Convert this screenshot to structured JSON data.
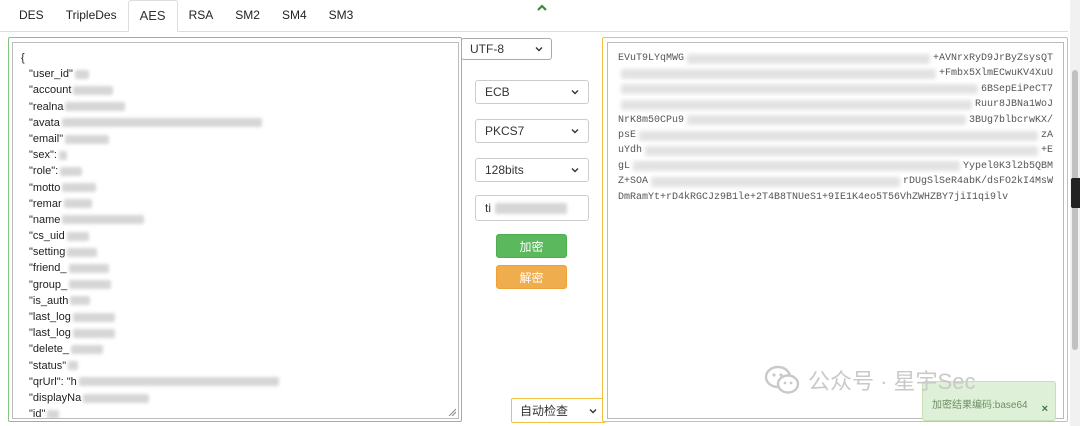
{
  "tabs": [
    {
      "label": "DES",
      "active": false
    },
    {
      "label": "TripleDes",
      "active": false
    },
    {
      "label": "AES",
      "active": true
    },
    {
      "label": "RSA",
      "active": false
    },
    {
      "label": "SM2",
      "active": false
    },
    {
      "label": "SM4",
      "active": false
    },
    {
      "label": "SM3",
      "active": false
    }
  ],
  "input": {
    "open_brace": "{",
    "close_brace": "}",
    "lines": [
      {
        "key": "\"user_id\"",
        "blur": 14
      },
      {
        "key": "\"account",
        "blur": 40
      },
      {
        "key": "\"realna",
        "blur": 60
      },
      {
        "key": "\"avata",
        "blur": 200
      },
      {
        "key": "\"email\"",
        "blur": 44
      },
      {
        "key": "\"sex\": ",
        "blur": 8
      },
      {
        "key": "\"role\":",
        "blur": 22
      },
      {
        "key": "\"motto",
        "blur": 34
      },
      {
        "key": "\"remar",
        "blur": 28
      },
      {
        "key": "\"name",
        "blur": 82
      },
      {
        "key": "\"cs_uid",
        "blur": 22
      },
      {
        "key": "\"setting",
        "blur": 30
      },
      {
        "key": "\"friend_",
        "blur": 40
      },
      {
        "key": "\"group_",
        "blur": 42
      },
      {
        "key": "\"is_auth",
        "blur": 20
      },
      {
        "key": "\"last_log",
        "blur": 42
      },
      {
        "key": "\"last_log",
        "blur": 42
      },
      {
        "key": "\"delete_",
        "blur": 32
      },
      {
        "key": "\"status\"",
        "blur": 10
      },
      {
        "key": "\"qrUrl\": \"h",
        "blur": 200
      },
      {
        "key": "\"displayNa",
        "blur": 66
      },
      {
        "key": "\"id\"",
        "blur": 12
      }
    ]
  },
  "controls": {
    "encoding": "UTF-8",
    "mode": "ECB",
    "padding": "PKCS7",
    "key_size": "128bits",
    "key_prefix": "ti",
    "encrypt_label": "加密",
    "decrypt_label": "解密",
    "output_format": "自动检查"
  },
  "output": {
    "lines": [
      {
        "start": "EVuT9LYqMWG",
        "end": "+AVNrxRyD9JrByZsysQT"
      },
      {
        "start": "",
        "end": "+Fmbx5XlmECwuKV4XuU"
      },
      {
        "start": "",
        "end": "6BSepEiPeCT7"
      },
      {
        "start": "",
        "end": "Ruur8JBNa1WoJ"
      },
      {
        "start": "NrK8m50CPu9",
        "end": "3BUg7blbcrwKX/"
      },
      {
        "start": "psE",
        "end": "zA"
      },
      {
        "start": "uYdh",
        "end": "+E"
      },
      {
        "start": "gL",
        "end": "Yypel0K3l2b5QBM"
      },
      {
        "start": "Z+SOA",
        "end": "rDUgSlSeR4abK/dsFO2kI4MsW"
      },
      {
        "start": "DmRamYt+rD4kRGCJz9B1le+2T4B8TNUeS1+9IE1K4eo5T56VhZWHZBY7jiI1qi9lv",
        "end": ""
      }
    ]
  },
  "watermark": {
    "text": "公众号 · 星宇Sec"
  },
  "toast": {
    "message": "加密结果编码:base64",
    "close": "×"
  },
  "colors": {
    "encrypt": "#5cb85c",
    "decrypt": "#f0ad4e",
    "left_border": "#7fc47f",
    "right_border": "#f0c040"
  }
}
